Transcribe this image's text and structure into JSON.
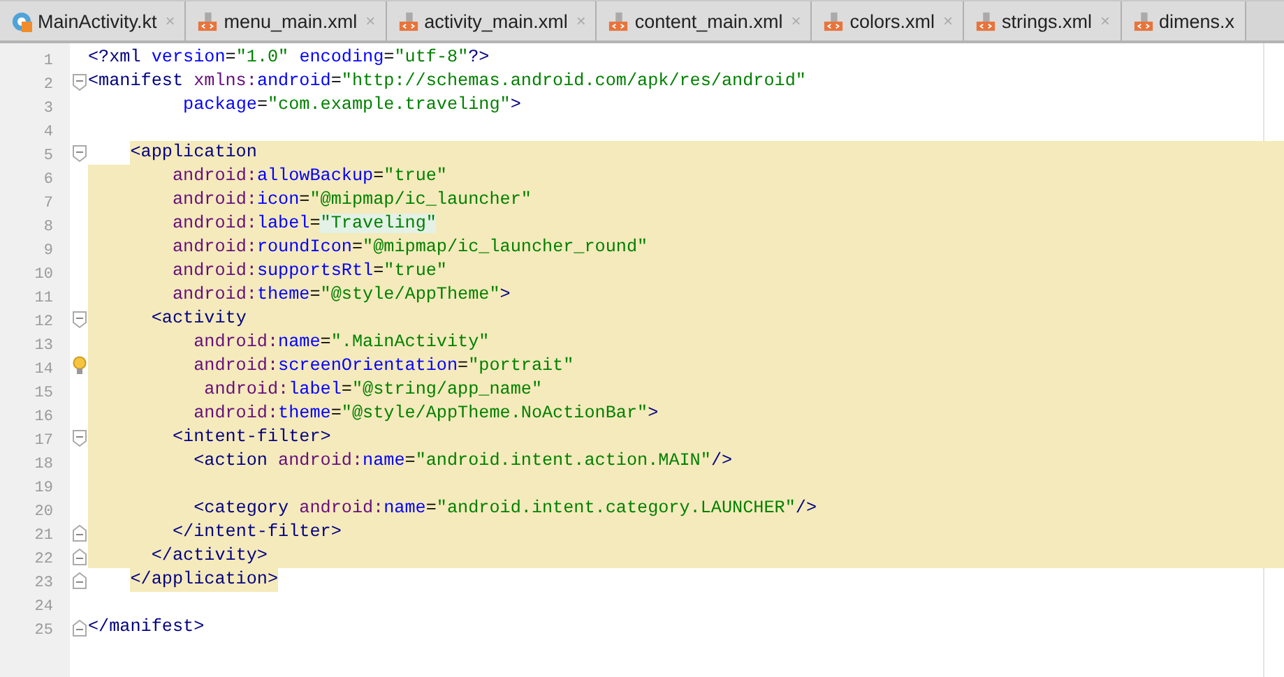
{
  "tabs": [
    {
      "label": "MainActivity.kt",
      "kind": "kotlin",
      "selected": false,
      "close": "×"
    },
    {
      "label": "menu_main.xml",
      "kind": "xml",
      "selected": false,
      "close": "×"
    },
    {
      "label": "activity_main.xml",
      "kind": "xml",
      "selected": false,
      "close": "×"
    },
    {
      "label": "content_main.xml",
      "kind": "xml",
      "selected": false,
      "close": "×"
    },
    {
      "label": "colors.xml",
      "kind": "xml",
      "selected": false,
      "close": "×"
    },
    {
      "label": "strings.xml",
      "kind": "xml",
      "selected": false,
      "close": "×"
    },
    {
      "label": "dimens.x",
      "kind": "xml",
      "selected": false
    }
  ],
  "lines": [
    {
      "number": "1",
      "tokens": [
        {
          "kind": "tag",
          "text": "<?xml "
        },
        {
          "kind": "attr",
          "text": "version"
        },
        {
          "kind": "plain",
          "text": "="
        },
        {
          "kind": "value",
          "text": "\"1.0\" "
        },
        {
          "kind": "attr",
          "text": "encoding"
        },
        {
          "kind": "plain",
          "text": "="
        },
        {
          "kind": "value",
          "text": "\"utf-8\""
        },
        {
          "kind": "tag",
          "text": "?>"
        }
      ]
    },
    {
      "number": "2",
      "fold_start": true,
      "tokens": [
        {
          "kind": "tag",
          "text": "<manifest "
        },
        {
          "kind": "ns",
          "text": "xmlns:"
        },
        {
          "kind": "attr",
          "text": "android"
        },
        {
          "kind": "plain",
          "text": "="
        },
        {
          "kind": "value",
          "text": "\"http://schemas.android.com/apk/res/android\""
        }
      ]
    },
    {
      "number": "3",
      "tokens": [
        {
          "kind": "attr",
          "text": "         package"
        },
        {
          "kind": "plain",
          "text": "="
        },
        {
          "kind": "value",
          "text": "\"com.example.traveling\""
        },
        {
          "kind": "tag",
          "text": ">"
        }
      ]
    },
    {
      "number": "4"
    },
    {
      "number": "5",
      "fold_start": true,
      "highlighted": true,
      "tokens": [
        {
          "kind": "tag",
          "text": "    <application"
        }
      ]
    },
    {
      "number": "6",
      "highlighted": true,
      "tokens": [
        {
          "kind": "ns",
          "text": "        android:"
        },
        {
          "kind": "attr",
          "text": "allowBackup"
        },
        {
          "kind": "plain",
          "text": "="
        },
        {
          "kind": "value",
          "text": "\"true\""
        }
      ]
    },
    {
      "number": "7",
      "highlighted": true,
      "tokens": [
        {
          "kind": "ns",
          "text": "        android:"
        },
        {
          "kind": "attr",
          "text": "icon"
        },
        {
          "kind": "plain",
          "text": "="
        },
        {
          "kind": "value",
          "text": "\"@mipmap/ic_launcher\""
        }
      ]
    },
    {
      "number": "8",
      "highlighted": true,
      "tokens": [
        {
          "kind": "ns",
          "text": "        android:"
        },
        {
          "kind": "attr",
          "text": "label"
        },
        {
          "kind": "plain",
          "text": "="
        },
        {
          "kind": "hint",
          "text": "\"Traveling\""
        }
      ]
    },
    {
      "number": "9",
      "highlighted": true,
      "tokens": [
        {
          "kind": "ns",
          "text": "        android:"
        },
        {
          "kind": "attr",
          "text": "roundIcon"
        },
        {
          "kind": "plain",
          "text": "="
        },
        {
          "kind": "value",
          "text": "\"@mipmap/ic_launcher_round\""
        }
      ]
    },
    {
      "number": "10",
      "highlighted": true,
      "tokens": [
        {
          "kind": "ns",
          "text": "        android:"
        },
        {
          "kind": "attr",
          "text": "supportsRtl"
        },
        {
          "kind": "plain",
          "text": "="
        },
        {
          "kind": "value",
          "text": "\"true\""
        }
      ]
    },
    {
      "number": "11",
      "highlighted": true,
      "tokens": [
        {
          "kind": "ns",
          "text": "        android:"
        },
        {
          "kind": "attr",
          "text": "theme"
        },
        {
          "kind": "plain",
          "text": "="
        },
        {
          "kind": "value",
          "text": "\"@style/AppTheme\""
        },
        {
          "kind": "tag",
          "text": ">"
        }
      ]
    },
    {
      "number": "12",
      "fold_start": true,
      "highlighted": true,
      "tokens": [
        {
          "kind": "tag",
          "text": "      <activity"
        }
      ]
    },
    {
      "number": "13",
      "highlighted": true,
      "tokens": [
        {
          "kind": "ns",
          "text": "          android:"
        },
        {
          "kind": "attr",
          "text": "name"
        },
        {
          "kind": "plain",
          "text": "="
        },
        {
          "kind": "value",
          "text": "\".MainActivity\""
        }
      ]
    },
    {
      "number": "14",
      "highlighted": true,
      "current": true,
      "tokens": [
        {
          "kind": "ns",
          "text": "          android:"
        },
        {
          "kind": "attr",
          "text": "screenOrientation"
        },
        {
          "kind": "plain",
          "text": "="
        },
        {
          "kind": "value",
          "text": "\"portrait\""
        }
      ]
    },
    {
      "number": "15",
      "highlighted": true,
      "tokens": [
        {
          "kind": "ns",
          "text": "           android:"
        },
        {
          "kind": "attr",
          "text": "label"
        },
        {
          "kind": "plain",
          "text": "="
        },
        {
          "kind": "value",
          "text": "\"@string/app_name\""
        }
      ]
    },
    {
      "number": "16",
      "highlighted": true,
      "tokens": [
        {
          "kind": "ns",
          "text": "          android:"
        },
        {
          "kind": "attr",
          "text": "theme"
        },
        {
          "kind": "plain",
          "text": "="
        },
        {
          "kind": "value",
          "text": "\"@style/AppTheme.NoActionBar\""
        },
        {
          "kind": "tag",
          "text": ">"
        }
      ]
    },
    {
      "number": "17",
      "fold_start": true,
      "highlighted": true,
      "tokens": [
        {
          "kind": "tag",
          "text": "        <intent-filter>"
        }
      ]
    },
    {
      "number": "18",
      "highlighted": true,
      "tokens": [
        {
          "kind": "tag",
          "text": "          <action "
        },
        {
          "kind": "ns",
          "text": "android:"
        },
        {
          "kind": "attr",
          "text": "name"
        },
        {
          "kind": "plain",
          "text": "="
        },
        {
          "kind": "value",
          "text": "\"android.intent.action.MAIN\""
        },
        {
          "kind": "tag",
          "text": "/>"
        }
      ]
    },
    {
      "number": "19",
      "highlighted": true
    },
    {
      "number": "20",
      "highlighted": true,
      "tokens": [
        {
          "kind": "tag",
          "text": "          <category "
        },
        {
          "kind": "ns",
          "text": "android:"
        },
        {
          "kind": "attr",
          "text": "name"
        },
        {
          "kind": "plain",
          "text": "="
        },
        {
          "kind": "value",
          "text": "\"android.intent.category.LAUNCHER\""
        },
        {
          "kind": "tag",
          "text": "/>"
        }
      ]
    },
    {
      "number": "21",
      "fold_end": true,
      "highlighted": true,
      "tokens": [
        {
          "kind": "tag",
          "text": "        </intent-filter>"
        }
      ]
    },
    {
      "number": "22",
      "fold_end": true,
      "highlighted": true,
      "tokens": [
        {
          "kind": "tag",
          "text": "      </activity>"
        }
      ]
    },
    {
      "number": "23",
      "fold_end": true,
      "highlighted": true,
      "tokens": [
        {
          "kind": "tag",
          "text": "    </application>"
        }
      ]
    },
    {
      "number": "24"
    },
    {
      "number": "25",
      "fold_end": true,
      "tokens": [
        {
          "kind": "tag",
          "text": "</manifest>"
        }
      ]
    }
  ]
}
